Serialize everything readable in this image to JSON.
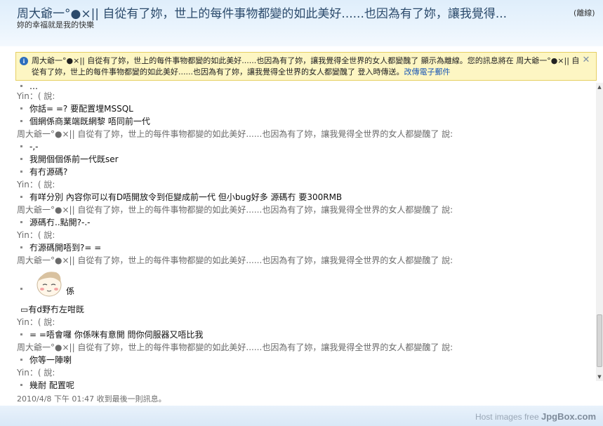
{
  "window": {
    "title": "周大爺一°●×|| 自從有了妳，世上的每件事物都變的如此美好......也因為有了妳，讓我覺得...",
    "status": "(離線)",
    "subtitle": "妳的幸福就是我的快樂"
  },
  "notice": {
    "text": "周大爺一°●×|| 自從有了妳，世上的每件事物都變的如此美好......也因為有了妳，讓我覺得全世界的女人都變醜了 顯示為離線。您的訊息將在 周大爺一°●×|| 自從有了妳，世上的每件事物都變的如此美好......也因為有了妳，讓我覺得全世界的女人都變醜了 登入時傳送。",
    "link": "改傳電子郵件",
    "icon": "info-icon",
    "close_icon": "close-icon"
  },
  "chat": {
    "speaker_a": "Yin：( 說:",
    "speaker_b": "周大爺一°●×|| 自從有了妳，世上的每件事物都變的如此美好......也因為有了妳，讓我覺得全世界的女人都變醜了 說:",
    "lines": [
      "你話= =? 要配置埋MSSQL",
      "個網係商業端既網黎 唔同前一代",
      "-,-",
      "我開個個係前一代既ser",
      "有冇源碼?",
      "有咩分別 內容你可以有D唔開放令到佢變成前一代 但小bug好多 源碼冇 要300RMB",
      "源碼冇..點開?-.-",
      "冇源碼開唔到?= =",
      "係",
      "▭有d野冇左咁既",
      "= =唔會囉 你係咪有意開 問你伺服器又唔比我",
      "你等一陣喇",
      "幾耐 配置呢"
    ],
    "timestamp": "2010/4/8 下午 01:47 收到最後一則訊息。"
  },
  "footer": {
    "watermark_prefix": "Host images free ",
    "watermark_brand": "JpgBox.com"
  }
}
